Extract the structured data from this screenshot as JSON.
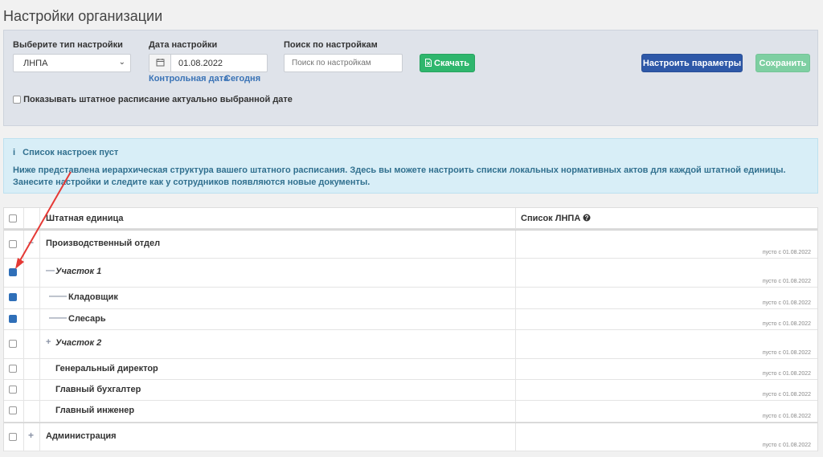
{
  "page": {
    "title": "Настройки организации"
  },
  "filters": {
    "type_label": "Выберите тип настройки",
    "type_value": "ЛНПА",
    "date_label": "Дата настройки",
    "date_value": "01.08.2022",
    "link_control": "Контрольная дата",
    "link_today": "Сегодня",
    "search_label": "Поиск по настройкам",
    "search_placeholder": "Поиск по настройкам",
    "download_label": "Скачать",
    "configure_label": "Настроить параметры",
    "save_label": "Сохранить",
    "show_staff_label": "Показывать штатное расписание актуально выбранной дате"
  },
  "info": {
    "title": "Список настроек пуст",
    "text": "Ниже представлена иерархическая структура вашего штатного расписания. Здесь вы можете настроить списки локальных нормативных актов для каждой штатной единицы. Занесите настройки и следите как у сотрудников появляются новые документы."
  },
  "table": {
    "col_unit": "Штатная единица",
    "col_lnpa": "Список ЛНПА",
    "rows": [
      {
        "name": "Производственный отдел",
        "meta": "пусто с 01.08.2022",
        "checked": false,
        "expander": "−",
        "italic": false,
        "prefix": ""
      },
      {
        "name": "Участок 1",
        "meta": "пусто с 01.08.2022",
        "checked": true,
        "expander": "",
        "italic": true,
        "prefix": "—"
      },
      {
        "name": "Кладовщик",
        "meta": "пусто с 01.08.2022",
        "checked": true,
        "expander": "",
        "italic": false,
        "prefix": "——"
      },
      {
        "name": "Слесарь",
        "meta": "пусто с 01.08.2022",
        "checked": true,
        "expander": "",
        "italic": false,
        "prefix": "——"
      },
      {
        "name": "Участок 2",
        "meta": "пусто с 01.08.2022",
        "checked": false,
        "expander": "",
        "italic": true,
        "prefix": "+"
      },
      {
        "name": "Генеральный директор",
        "meta": "пусто с 01.08.2022",
        "checked": false,
        "expander": "",
        "italic": false,
        "prefix": ""
      },
      {
        "name": "Главный бухгалтер",
        "meta": "пусто с 01.08.2022",
        "checked": false,
        "expander": "",
        "italic": false,
        "prefix": ""
      },
      {
        "name": "Главный инженер",
        "meta": "пусто с 01.08.2022",
        "checked": false,
        "expander": "",
        "italic": false,
        "prefix": ""
      },
      {
        "name": "Администрация",
        "meta": "пусто с 01.08.2022",
        "checked": false,
        "expander": "+",
        "italic": false,
        "prefix": ""
      }
    ]
  },
  "colors": {
    "accent": "#2e58a8",
    "success": "#2fb66d",
    "info_text": "#31708f",
    "annotation_arrow": "#e53935"
  },
  "icons": {
    "date": "calendar-icon",
    "download": "file-excel-icon",
    "info": "info-icon",
    "help": "question-circle-icon",
    "dropdown": "chevron-down-icon"
  }
}
